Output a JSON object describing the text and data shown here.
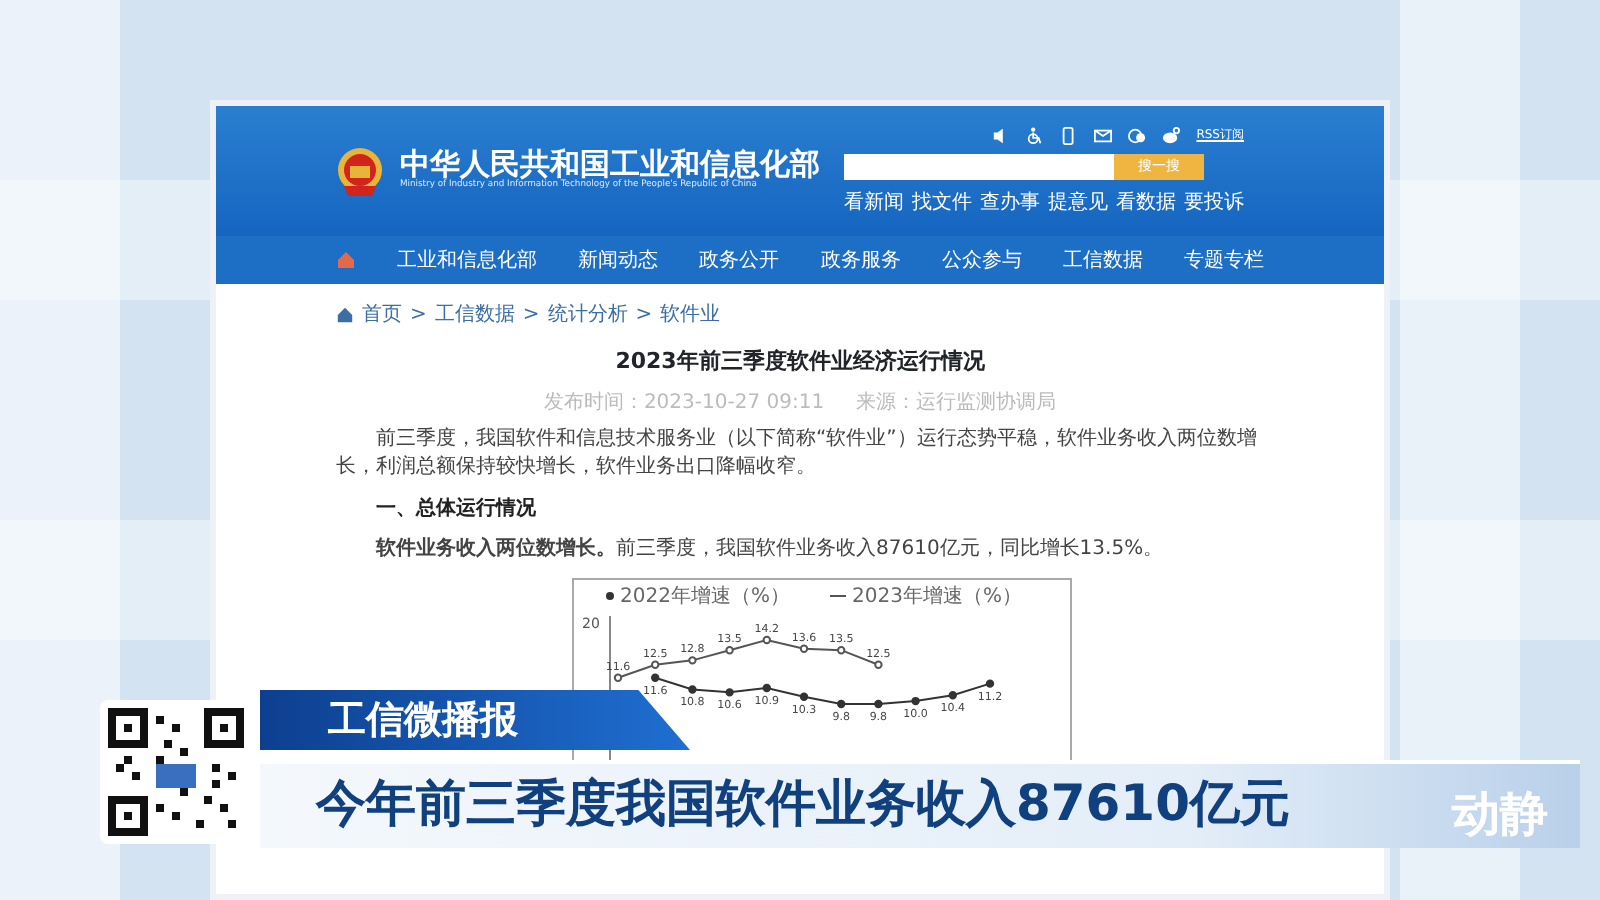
{
  "site_header": {
    "title": "中华人民共和国工业和信息化部",
    "subtitle": "Ministry of Industry and Information Technology of the People's Republic of China",
    "rss": "RSS订阅",
    "search_button": "搜一搜",
    "quick_links": [
      "看新闻",
      "找文件",
      "查办事",
      "提意见",
      "看数据",
      "要投诉"
    ]
  },
  "nav": [
    "工业和信息化部",
    "新闻动态",
    "政务公开",
    "政务服务",
    "公众参与",
    "工信数据",
    "专题专栏"
  ],
  "breadcrumb": {
    "separator": ">",
    "items": [
      "首页",
      "工信数据",
      "统计分析",
      "软件业"
    ]
  },
  "article": {
    "title": "2023年前三季度软件业经济运行情况",
    "meta": [
      "发布时间：2023-10-27 09:11",
      "来源：运行监测协调局"
    ],
    "paragraphs": [
      {
        "kind": "text",
        "text": "前三季度，我国软件和信息技术服务业（以下简称“软件业”）运行态势平稳，软件业务收入两位数增长，利润总额保持较快增长，软件业务出口降幅收窄。"
      },
      {
        "kind": "heading",
        "text": "一、总体运行情况"
      },
      {
        "kind": "text",
        "text": "**软件业务收入两位数增长。**前三季度，我国软件业务收入87610亿元，同比增长13.5%。"
      }
    ],
    "chart_data": {
      "type": "line",
      "legend": "top",
      "annotations": [
        {
          "text": "20"
        }
      ],
      "series": [
        {
          "name": "2022年增速（%）",
          "color": "#333333",
          "marker": "filled-circle",
          "values": [
            null,
            11.6,
            10.8,
            10.6,
            10.9,
            10.3,
            9.8,
            9.8,
            10.0,
            10.4,
            11.2
          ],
          "value_labels": [
            null,
            "11.6",
            "10.8",
            "10.6",
            "10.9",
            "10.3",
            "9.8",
            "9.8",
            "10.0",
            "10.4",
            "11.2"
          ]
        },
        {
          "name": "2023年增速（%）",
          "color": "#555555",
          "marker": "hollow-circle",
          "values": [
            11.6,
            12.5,
            12.8,
            13.5,
            14.2,
            13.6,
            13.5,
            12.5,
            null,
            null,
            null
          ],
          "value_labels": [
            "11.6",
            "12.5",
            "12.8",
            "13.5",
            "14.2",
            "13.6",
            "13.5",
            "12.5",
            null,
            null,
            null
          ]
        }
      ]
    }
  },
  "overlay": {
    "tag": "工信微播报",
    "headline": "今年前三季度我国软件业务收入87610亿元",
    "logo": "动静"
  }
}
